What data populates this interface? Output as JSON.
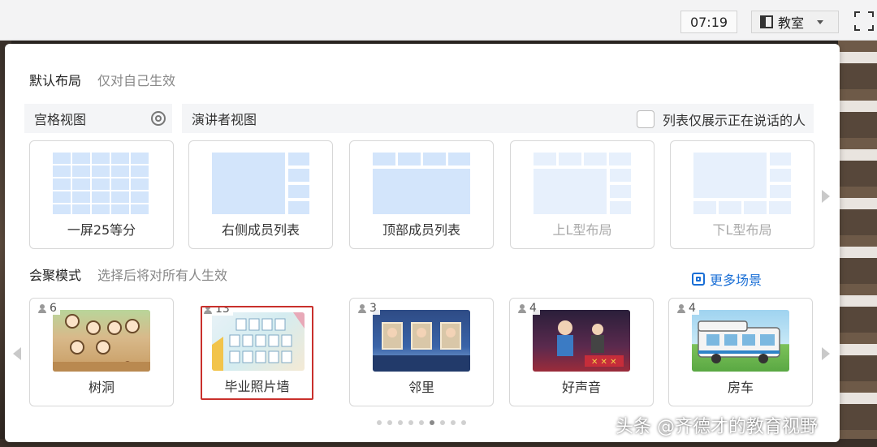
{
  "topbar": {
    "timer": "07:19",
    "view_label": "教室"
  },
  "default_layout": {
    "title": "默认布局",
    "subtitle": "仅对自己生效",
    "tab_grid": "宫格视图",
    "tab_speaker": "演讲者视图",
    "checkbox_label": "列表仅展示正在说话的人",
    "cards": [
      {
        "label": "一屏25等分",
        "disabled": false
      },
      {
        "label": "右侧成员列表",
        "disabled": false
      },
      {
        "label": "顶部成员列表",
        "disabled": false
      },
      {
        "label": "上L型布局",
        "disabled": true
      },
      {
        "label": "下L型布局",
        "disabled": true
      }
    ]
  },
  "gathering_mode": {
    "title": "会聚模式",
    "subtitle": "选择后将对所有人生效",
    "more_label": "更多场景",
    "scenes": [
      {
        "label": "树洞",
        "count": "6",
        "selected": false
      },
      {
        "label": "毕业照片墙",
        "count": "13",
        "selected": true
      },
      {
        "label": "邻里",
        "count": "3",
        "selected": false
      },
      {
        "label": "好声音",
        "count": "4",
        "selected": false
      },
      {
        "label": "房车",
        "count": "4",
        "selected": false
      }
    ]
  },
  "pagination": {
    "total": 9,
    "active": 5
  },
  "watermark": "头条 @齐德才的教育视野",
  "colors": {
    "accent_blue": "#1a6fd6",
    "layout_block": "#d3e5fb",
    "selected_border": "#c9302c"
  }
}
